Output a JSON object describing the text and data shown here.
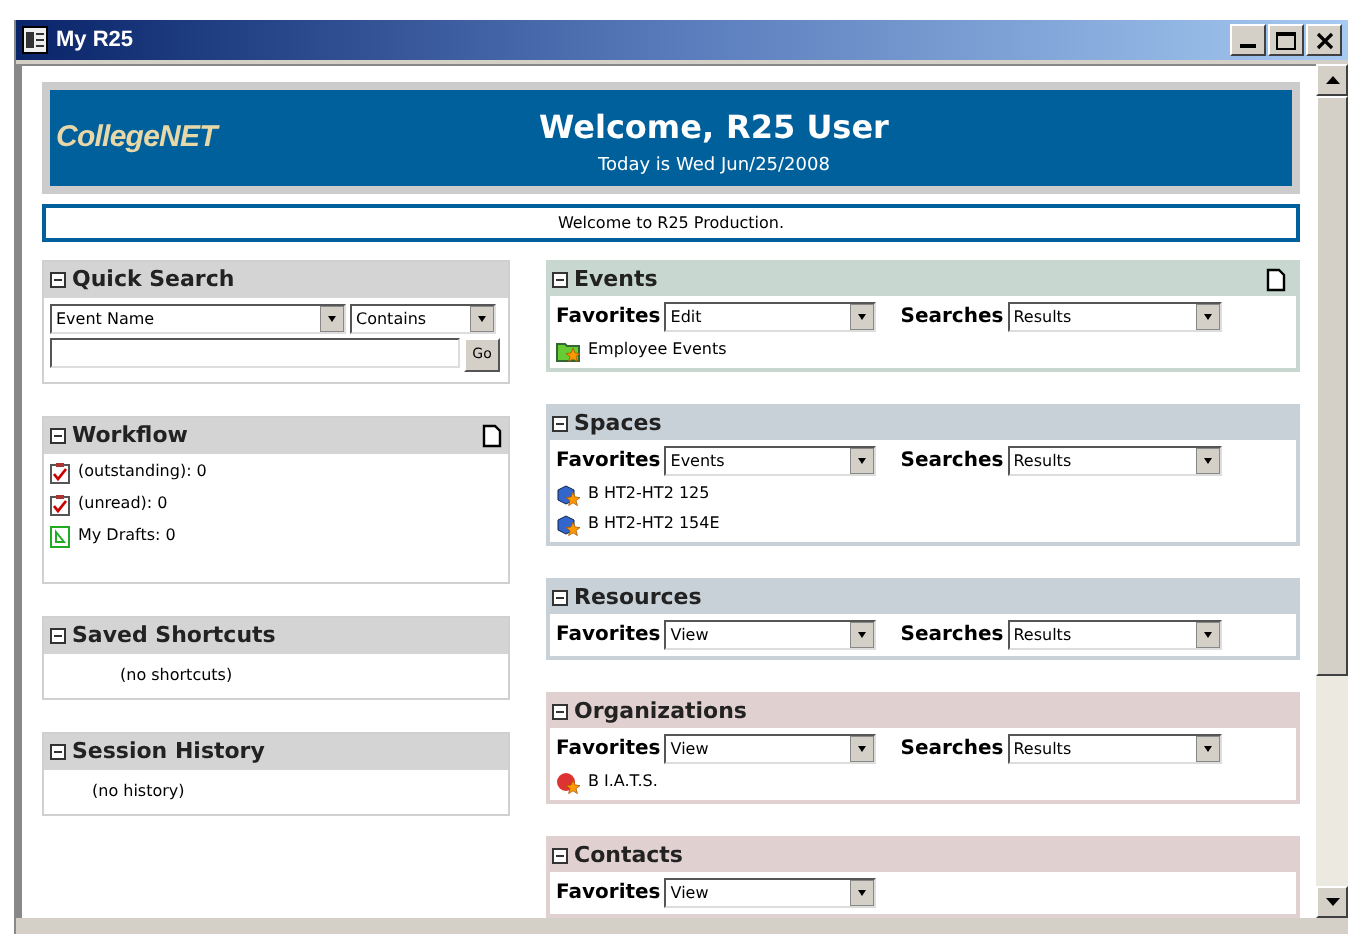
{
  "window": {
    "title": "My R25"
  },
  "banner": {
    "logo": "CollegeNET",
    "welcome": "Welcome,",
    "user": "R25 User",
    "date": "Today is Wed Jun/25/2008"
  },
  "message": "Welcome to R25 Production.",
  "quick_search": {
    "title": "Quick Search",
    "field_select": "Event Name",
    "operator_select": "Contains",
    "go_button": "Go"
  },
  "workflow": {
    "title": "Workflow",
    "items": [
      {
        "kind": "task",
        "label": "(outstanding): 0"
      },
      {
        "kind": "task",
        "label": "(unread): 0"
      },
      {
        "kind": "draft",
        "label": "My Drafts: 0"
      }
    ]
  },
  "saved_shortcuts": {
    "title": "Saved Shortcuts",
    "empty": "(no shortcuts)"
  },
  "session_history": {
    "title": "Session History",
    "empty": "(no history)"
  },
  "panels": [
    {
      "title": "Events",
      "color": "#c8d8d0",
      "new_icon": true,
      "favorites_label": "Favorites",
      "favorites": "Edit",
      "searches_label": "Searches",
      "searches": "Results",
      "items": [
        {
          "kind": "event",
          "label": "Employee Events"
        }
      ]
    },
    {
      "title": "Spaces",
      "color": "#c8d0d8",
      "new_icon": false,
      "favorites_label": "Favorites",
      "favorites": "Events",
      "searches_label": "Searches",
      "searches": "Results",
      "items": [
        {
          "kind": "space",
          "label": "B HT2-HT2 125"
        },
        {
          "kind": "space",
          "label": "B HT2-HT2 154E"
        }
      ]
    },
    {
      "title": "Resources",
      "color": "#c8d0d8",
      "new_icon": false,
      "favorites_label": "Favorites",
      "favorites": "View",
      "searches_label": "Searches",
      "searches": "Results"
    },
    {
      "title": "Organizations",
      "color": "#e0d0d0",
      "new_icon": false,
      "favorites_label": "Favorites",
      "favorites": "View",
      "searches_label": "Searches",
      "searches": "Results",
      "items": [
        {
          "kind": "organization",
          "label": "B I.A.T.S."
        }
      ]
    },
    {
      "title": "Contacts",
      "color": "#e0d0d0",
      "new_icon": false,
      "favorites_label": "Favorites",
      "favorites": "View"
    }
  ]
}
